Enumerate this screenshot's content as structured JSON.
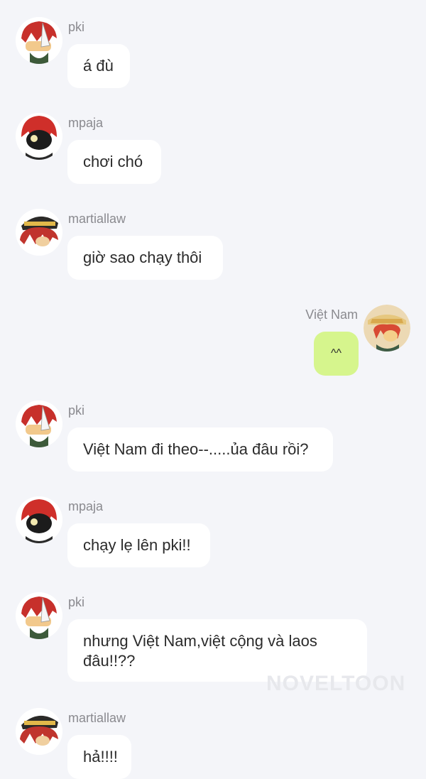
{
  "messages": [
    {
      "sender": "pki",
      "text": "á đù",
      "side": "left",
      "avatar": "pki-avatar"
    },
    {
      "sender": "mpaja",
      "text": "chơi chó",
      "side": "left",
      "avatar": "mpaja-avatar"
    },
    {
      "sender": "martiallaw",
      "text": "giờ sao chạy thôi",
      "side": "left",
      "avatar": "martiallaw-avatar"
    },
    {
      "sender": "Việt Nam",
      "text": "^^",
      "side": "right",
      "avatar": "vietnam-avatar"
    },
    {
      "sender": "pki",
      "text": "Việt Nam đi theo--.....ủa đâu rồi?",
      "side": "left",
      "avatar": "pki-avatar"
    },
    {
      "sender": "mpaja",
      "text": "chạy lẹ lên pki!!",
      "side": "left",
      "avatar": "mpaja-avatar"
    },
    {
      "sender": "pki",
      "text": "nhưng Việt Nam,việt cộng và laos đâu!!??",
      "side": "left",
      "avatar": "pki-avatar"
    },
    {
      "sender": "martiallaw",
      "text": "hả!!!!",
      "side": "left",
      "avatar": "martiallaw-avatar"
    }
  ],
  "watermark": "NOVELTOON",
  "colors": {
    "background": "#f4f5f9",
    "bubble_left": "#ffffff",
    "bubble_right": "#d6f58d",
    "name": "#8a8a8f"
  }
}
